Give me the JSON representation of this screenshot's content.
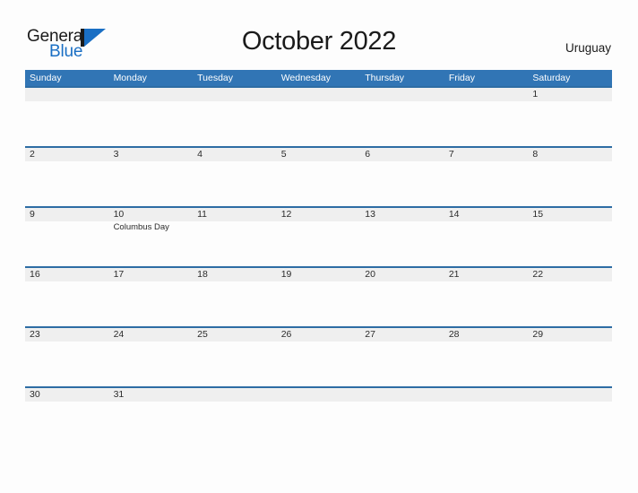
{
  "brand": {
    "word_one": "General",
    "word_two": "Blue",
    "mark_icon": "general-blue-sail-logo",
    "accent_color": "#1a6fc4",
    "text_color": "#1b1b1b"
  },
  "header": {
    "title": "October 2022",
    "country": "Uruguay"
  },
  "theme": {
    "header_blue": "#3175b5",
    "rule_blue": "#2e6da4",
    "band_gray": "#efefef",
    "page_background": "#fdfdfd"
  },
  "calendar": {
    "month": "October",
    "year": "2022",
    "weekday_headers": [
      "Sunday",
      "Monday",
      "Tuesday",
      "Wednesday",
      "Thursday",
      "Friday",
      "Saturday"
    ],
    "weeks": [
      [
        {
          "day": "",
          "events": []
        },
        {
          "day": "",
          "events": []
        },
        {
          "day": "",
          "events": []
        },
        {
          "day": "",
          "events": []
        },
        {
          "day": "",
          "events": []
        },
        {
          "day": "",
          "events": []
        },
        {
          "day": "1",
          "events": []
        }
      ],
      [
        {
          "day": "2",
          "events": []
        },
        {
          "day": "3",
          "events": []
        },
        {
          "day": "4",
          "events": []
        },
        {
          "day": "5",
          "events": []
        },
        {
          "day": "6",
          "events": []
        },
        {
          "day": "7",
          "events": []
        },
        {
          "day": "8",
          "events": []
        }
      ],
      [
        {
          "day": "9",
          "events": []
        },
        {
          "day": "10",
          "events": [
            "Columbus Day"
          ]
        },
        {
          "day": "11",
          "events": []
        },
        {
          "day": "12",
          "events": []
        },
        {
          "day": "13",
          "events": []
        },
        {
          "day": "14",
          "events": []
        },
        {
          "day": "15",
          "events": []
        }
      ],
      [
        {
          "day": "16",
          "events": []
        },
        {
          "day": "17",
          "events": []
        },
        {
          "day": "18",
          "events": []
        },
        {
          "day": "19",
          "events": []
        },
        {
          "day": "20",
          "events": []
        },
        {
          "day": "21",
          "events": []
        },
        {
          "day": "22",
          "events": []
        }
      ],
      [
        {
          "day": "23",
          "events": []
        },
        {
          "day": "24",
          "events": []
        },
        {
          "day": "25",
          "events": []
        },
        {
          "day": "26",
          "events": []
        },
        {
          "day": "27",
          "events": []
        },
        {
          "day": "28",
          "events": []
        },
        {
          "day": "29",
          "events": []
        }
      ],
      [
        {
          "day": "30",
          "events": []
        },
        {
          "day": "31",
          "events": []
        },
        {
          "day": "",
          "events": []
        },
        {
          "day": "",
          "events": []
        },
        {
          "day": "",
          "events": []
        },
        {
          "day": "",
          "events": []
        },
        {
          "day": "",
          "events": []
        }
      ]
    ]
  }
}
